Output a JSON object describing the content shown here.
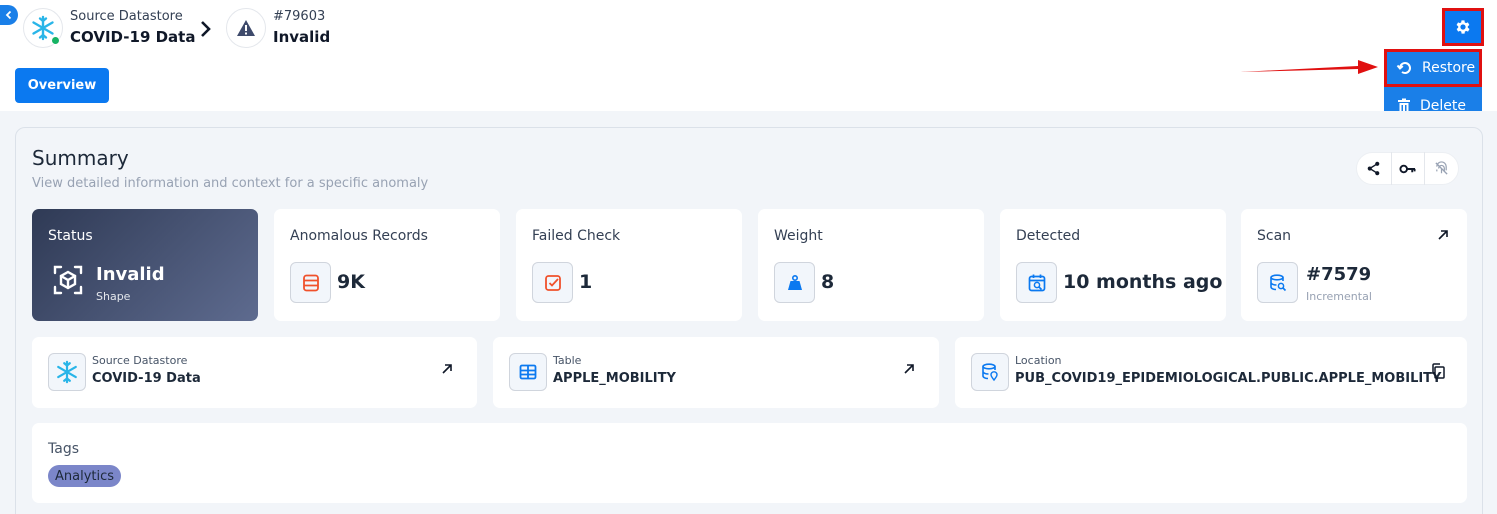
{
  "breadcrumb": {
    "datastore": {
      "label": "Source Datastore",
      "name": "COVID-19 Data",
      "icon": "snowflake-icon"
    },
    "anomaly": {
      "id": "#79603",
      "status": "Invalid",
      "icon": "warning-icon"
    }
  },
  "tabs": {
    "overview": "Overview"
  },
  "menu": {
    "restore": "Restore",
    "delete": "Delete"
  },
  "summary": {
    "title": "Summary",
    "subtitle": "View detailed information and context for a specific anomaly"
  },
  "cards": {
    "status": {
      "label": "Status",
      "value": "Invalid",
      "sub": "Shape"
    },
    "records": {
      "label": "Anomalous Records",
      "value": "9K"
    },
    "failed": {
      "label": "Failed Check",
      "value": "1"
    },
    "weight": {
      "label": "Weight",
      "value": "8"
    },
    "detected": {
      "label": "Detected",
      "value": "10 months ago"
    },
    "scan": {
      "label": "Scan",
      "value": "#7579",
      "sub": "Incremental"
    }
  },
  "details": {
    "datastore": {
      "label": "Source Datastore",
      "value": "COVID-19 Data"
    },
    "table": {
      "label": "Table",
      "value": "APPLE_MOBILITY"
    },
    "location": {
      "label": "Location",
      "value": "PUB_COVID19_EPIDEMIOLOGICAL.PUBLIC.APPLE_MOBILITY"
    }
  },
  "tags": {
    "label": "Tags",
    "items": [
      "Analytics"
    ]
  },
  "colors": {
    "primary": "#0b79f0",
    "highlight": "#e01010",
    "tag": "#7b86c9",
    "status_online": "#16b364"
  }
}
